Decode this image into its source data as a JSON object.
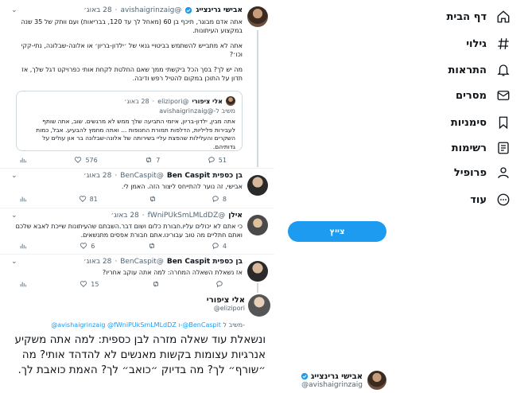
{
  "nav": {
    "items": [
      {
        "label": "דף הבית",
        "icon": "home-icon"
      },
      {
        "label": "גילוי",
        "icon": "hashtag-icon"
      },
      {
        "label": "התראות",
        "icon": "bell-icon"
      },
      {
        "label": "מסרים",
        "icon": "mail-icon"
      },
      {
        "label": "סימניות",
        "icon": "bookmark-icon"
      },
      {
        "label": "רשימות",
        "icon": "list-icon"
      },
      {
        "label": "פרופיל",
        "icon": "person-icon"
      },
      {
        "label": "עוד",
        "icon": "more-circle-icon"
      }
    ],
    "tweet_button": "צייץ"
  },
  "account": {
    "name": "אבישי גרינצייג",
    "handle": "@avishaigrinzaig"
  },
  "tweets": [
    {
      "name": "אבישי גרינצייג",
      "handle": "@avishaigrinzaig",
      "date": "28 באוג׳",
      "text": [
        "אתה אדם מבוגר, תיכף בן 60 (מאחל לך עד 120, בבריאות) ועם וותק של 35 שנה במקצוע העיתונות.",
        "אתה לא מתבייש להשתמש בביטויי גנאי של ׳ילדון-בריון׳ או אלונה-שבלונה, נתי-קקי וכו׳?",
        "מה יש לך? בסך הכל ביקשתי ממך שאם החלטת לקחת אותי כפרויקט דגל שלך, אז תדון על התוכן במקום להטיל רפש ודיבה."
      ],
      "quote": {
        "name": "אלי ציפורי",
        "handle": "@elizipori",
        "date": "28 באוג׳",
        "reply_to": "משיב ל-@avishaigrinzaig",
        "text": "אתה מבין, ילדון-בריון, איזמי התביעה שלך ממש לא מרגשים. שוב, אתה שותף לעבירות פליליות, הדלפות תמורת החנופות ... ואתה מחמץ להבעיע. אבל, כמות השקרים והעלילות שהפצת עליי בשירותה של אלונה-שבלונה בר און עולים על גדותיהם."
      },
      "stats": {
        "reply": "51",
        "retweet": "7",
        "like": "576"
      }
    },
    {
      "name": "בן כספית Ben Caspit",
      "handle": "@BenCaspit",
      "date": "28 באוג׳",
      "text": [
        "אבישי, זה נוער להתייחס ליצור הזה. האמן לי."
      ],
      "stats": {
        "reply": "8",
        "retweet": "",
        "like": "81"
      }
    },
    {
      "name": "אילן",
      "handle": "@fWniPUkSmLMLdDZ",
      "date": "28 באוג׳",
      "text": [
        "כי אתם לא יכולים עליו.חבורת כלום ושום דבר.השבתם שהעיתונות שייכת לאבא שלכם ואתם חתליים מה טוב עבורינו.אתם חבורת אפסים מתנשאים."
      ],
      "stats": {
        "reply": "4",
        "retweet": "",
        "like": "6"
      }
    },
    {
      "name": "בן כספית Ben Caspit",
      "handle": "@BenCaspit",
      "date": "28 באוג׳",
      "text": [
        "אז נשאלת השאלה המחרה: למה אתה עוקב אחריו?"
      ],
      "stats": {
        "reply": "",
        "retweet": "",
        "like": "15"
      }
    }
  ],
  "focus": {
    "name": "אלי ציפורי",
    "handle": "@elizipori",
    "reply_prefix": "משיב ל-",
    "reply_handles": "@avishaigrinzaig @fWniPUkSmLMLdDZ ו-@BenCaspit",
    "text": "ונשאלת עוד שאלה מזרה לבן כספית: למה אתה משקיע אנרגיות עצומות בקשות מאנשים לא להדהד אותי? מה ״שורף״ לך? מה בדיוק ״כואב״ לך? האמת כואבת לך."
  }
}
